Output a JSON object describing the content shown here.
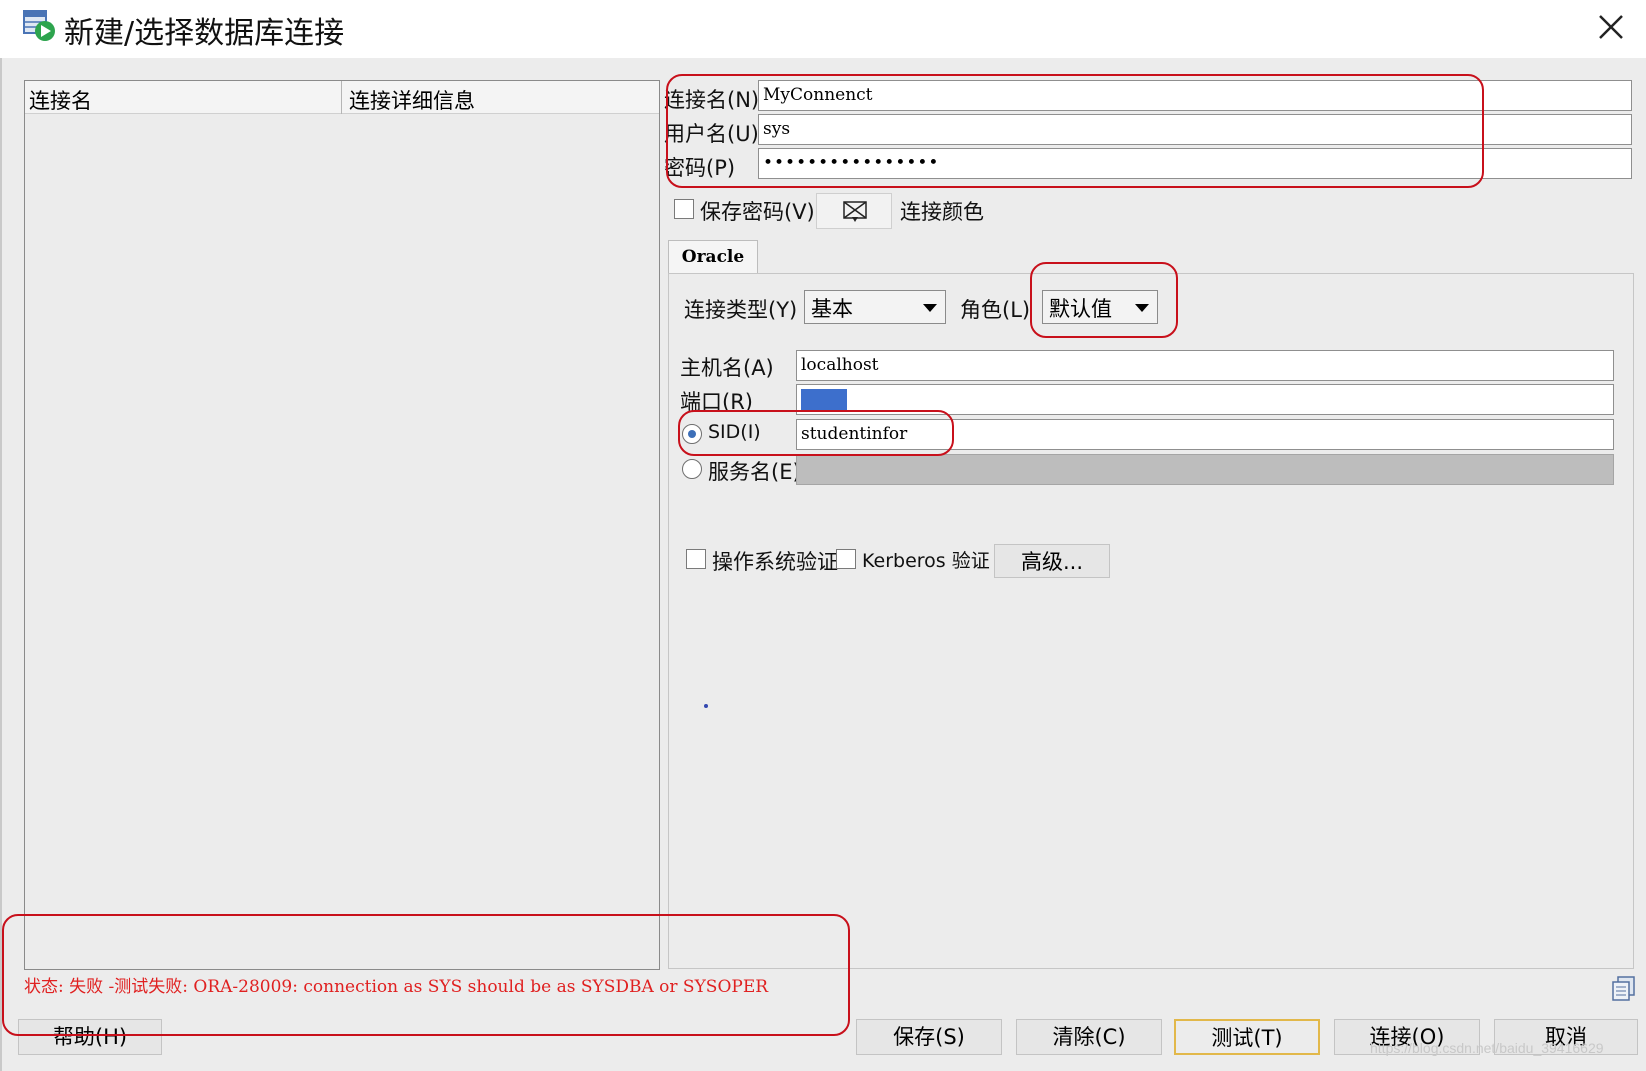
{
  "window": {
    "title": "新建/选择数据库连接",
    "app_icon": "database-connection-icon",
    "close_icon": "close-icon"
  },
  "connection_list": {
    "columns": [
      "连接名",
      "连接详细信息"
    ],
    "rows": []
  },
  "form": {
    "conn_name_label": "连接名(N)",
    "conn_name_value": "MyConnenct",
    "username_label": "用户名(U)",
    "username_value": "sys",
    "password_label": "密码(P)",
    "password_value": "••••••••••••••••",
    "save_password_label": "保存密码(V)",
    "save_password_checked": false,
    "conn_color_label": "连接颜色"
  },
  "oracle_tab": {
    "tab_label": "Oracle",
    "conn_type_label": "连接类型(Y)",
    "conn_type_value": "基本",
    "role_label": "角色(L)",
    "role_value": "默认值",
    "hostname_label": "主机名(A)",
    "hostname_value": "localhost",
    "port_label": "端口(R)",
    "port_value": "",
    "port_color": "#3d6fcc",
    "sid_label": "SID(I)",
    "sid_value": "studentinfor",
    "sid_selected": true,
    "service_label": "服务名(E)",
    "service_value": "",
    "os_auth_label": "操作系统验证",
    "kerberos_label": "Kerberos 验证",
    "advanced_label": "高级..."
  },
  "status": {
    "text": "状态: 失败 -测试失败: ORA-28009: connection as SYS should be as SYSDBA or SYSOPER",
    "color": "#e02020"
  },
  "buttons": {
    "help": "帮助(H)",
    "save": "保存(S)",
    "clear": "清除(C)",
    "test": "测试(T)",
    "connect": "连接(O)",
    "cancel": "取消"
  },
  "watermark": "https://blog.csdn.net/baidu_39416629",
  "colors": {
    "annotation_red": "#c8101b",
    "dialog_bg": "#ececec"
  }
}
